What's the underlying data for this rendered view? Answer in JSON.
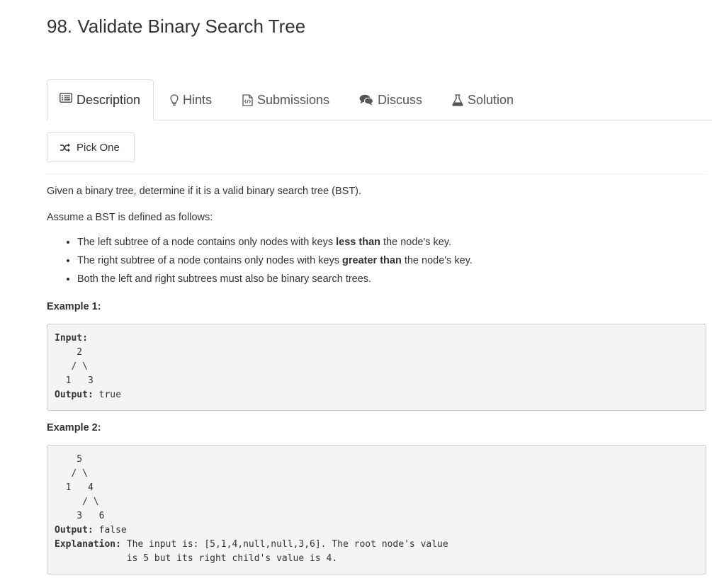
{
  "problem": {
    "title": "98. Validate Binary Search Tree"
  },
  "tabs": [
    {
      "label": "Description",
      "icon": "list-alt-icon",
      "active": true
    },
    {
      "label": "Hints",
      "icon": "lightbulb-icon",
      "active": false
    },
    {
      "label": "Submissions",
      "icon": "code-file-icon",
      "active": false
    },
    {
      "label": "Discuss",
      "icon": "comments-icon",
      "active": false
    },
    {
      "label": "Solution",
      "icon": "flask-icon",
      "active": false
    }
  ],
  "pick_one": {
    "label": "Pick One",
    "icon": "shuffle-icon"
  },
  "description": {
    "intro": "Given a binary tree, determine if it is a valid binary search tree (BST).",
    "assume": "Assume a BST is defined as follows:",
    "rules": [
      {
        "before": "The left subtree of a node contains only nodes with keys ",
        "bold": "less than",
        "after": " the node's key."
      },
      {
        "before": "The right subtree of a node contains only nodes with keys ",
        "bold": "greater than",
        "after": " the node's key."
      },
      {
        "before": "Both the left and right subtrees must also be binary search trees.",
        "bold": "",
        "after": ""
      }
    ]
  },
  "example1": {
    "label": "Example 1:",
    "input_label": "Input:",
    "tree": "    2\n   / \\\n  1   3",
    "output_label": "Output:",
    "output_value": "true"
  },
  "example2": {
    "label": "Example 2:",
    "tree": "    5\n   / \\\n  1   4\n     / \\\n    3   6",
    "output_label": "Output:",
    "output_value": "false",
    "explanation_label": "Explanation:",
    "explanation_line1": "The input is: [5,1,4,null,null,3,6]. The root node's value",
    "explanation_line2": "             is 5 but its right child's value is 4."
  }
}
